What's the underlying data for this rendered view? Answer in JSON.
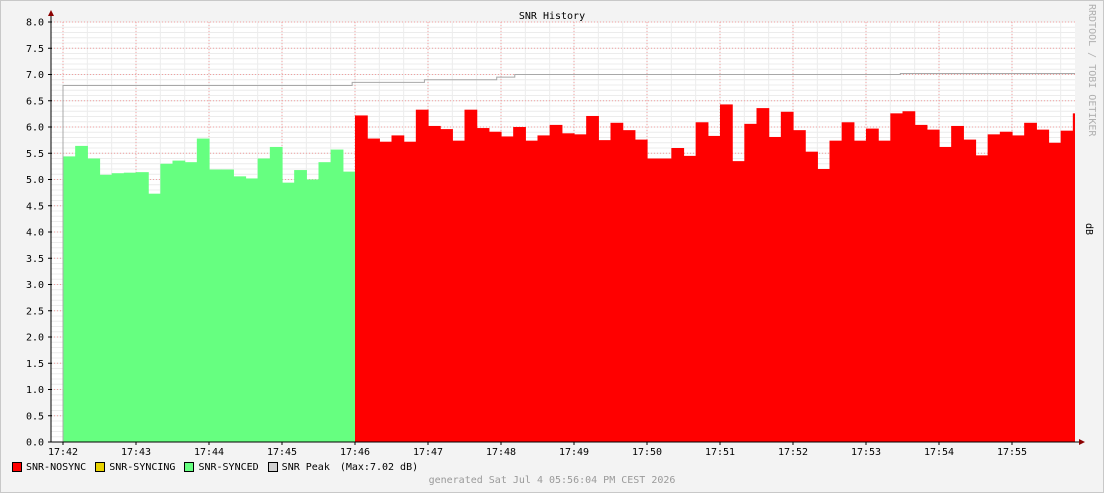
{
  "chart_data": {
    "type": "area",
    "title": "SNR History",
    "ylabel": "dB",
    "ylim": [
      0,
      8.0
    ],
    "y_ticks": [
      "0.0",
      "0.5",
      "1.0",
      "1.5",
      "2.0",
      "2.5",
      "3.0",
      "3.5",
      "4.0",
      "4.5",
      "5.0",
      "5.5",
      "6.0",
      "6.5",
      "7.0",
      "7.5",
      "8.0"
    ],
    "x_ticks": [
      "17:42",
      "17:43",
      "17:44",
      "17:45",
      "17:46",
      "17:47",
      "17:48",
      "17:49",
      "17:50",
      "17:51",
      "17:52",
      "17:53",
      "17:54",
      "17:55"
    ],
    "x_range_minutes": [
      "17:41:50",
      "17:55:50"
    ],
    "grid": true,
    "series": [
      {
        "name": "SNR-SYNCED",
        "color": "#66ff80",
        "values": [
          5.44,
          5.64,
          5.4,
          5.09,
          5.12,
          5.13,
          5.14,
          4.73,
          5.3,
          5.36,
          5.33,
          5.78,
          5.19,
          5.19,
          5.06,
          5.02,
          5.4,
          5.62,
          4.94,
          5.18,
          5.0,
          5.33,
          5.57,
          5.15
        ]
      },
      {
        "name": "SNR-NOSYNC",
        "color": "#ff0000",
        "values": [
          6.22,
          5.78,
          5.72,
          5.84,
          5.72,
          6.33,
          6.02,
          5.96,
          5.74,
          6.33,
          5.98,
          5.91,
          5.82,
          6.0,
          5.74,
          5.84,
          6.04,
          5.88,
          5.86,
          6.21,
          5.75,
          6.08,
          5.94,
          5.76,
          5.4,
          5.4,
          5.6,
          5.45,
          6.09,
          5.83,
          6.43,
          5.35,
          6.06,
          6.36,
          5.81,
          6.29,
          5.94,
          5.53,
          5.2,
          5.74,
          6.09,
          5.74,
          5.97,
          5.74,
          6.26,
          6.3,
          6.04,
          5.95,
          5.62,
          6.02,
          5.76,
          5.46,
          5.86,
          5.91,
          5.84,
          6.08,
          5.95,
          5.7,
          5.93,
          6.26
        ]
      },
      {
        "name": "SNR-SYNCING",
        "color": "#e8d200",
        "values": []
      }
    ],
    "peak_steps": [
      {
        "from": 0,
        "value": 6.79
      },
      {
        "from": 48,
        "value": 6.85
      },
      {
        "from": 60,
        "value": 6.9
      },
      {
        "from": 72,
        "value": 6.95
      },
      {
        "from": 75,
        "value": 7.0
      },
      {
        "from": 139,
        "value": 7.02
      }
    ],
    "peak_start_value": 0.0
  },
  "legend": [
    {
      "label": "SNR-NOSYNC",
      "color": "#ff0000"
    },
    {
      "label": "SNR-SYNCING",
      "color": "#e8d200"
    },
    {
      "label": "SNR-SYNCED",
      "color": "#66ff80"
    },
    {
      "label": "SNR Peak",
      "color": "#d0d0d0"
    }
  ],
  "legend_max": "(Max:7.02 dB)",
  "footer": "generated Sat Jul  4 05:56:04 PM CEST 2026",
  "watermark": "RRDTOOL / TOBI OETIKER",
  "unit_label": "dB"
}
